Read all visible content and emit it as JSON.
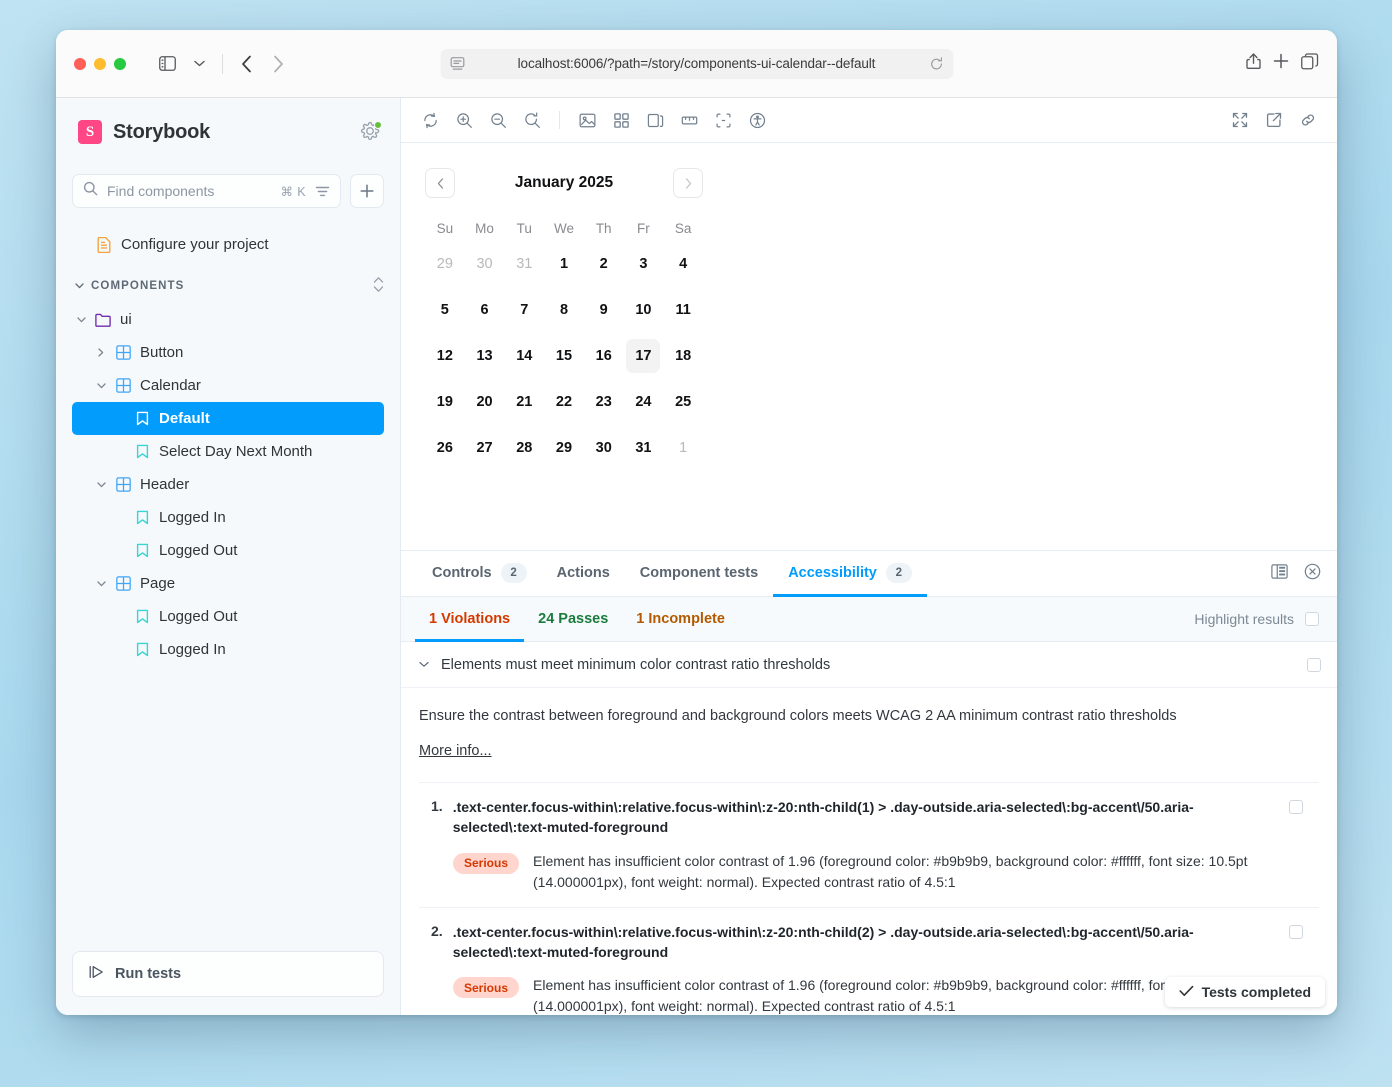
{
  "browser": {
    "url": "localhost:6006/?path=/story/components-ui-calendar--default",
    "back_icon": "chevron-left-icon",
    "forward_icon": "chevron-right-icon",
    "sidebar_toggle_icon": "sidebar-icon",
    "tab_dropdown_icon": "chevron-down-icon",
    "reader_icon": "reader-view-icon",
    "reload_icon": "reload-icon",
    "share_icon": "share-icon",
    "new_tab_icon": "plus-icon",
    "tab_overview_icon": "tabs-icon"
  },
  "sidebar": {
    "brand": "Storybook",
    "logo_letter": "S",
    "status_icon": "gear-icon",
    "search": {
      "placeholder": "Find components",
      "shortcut": "⌘ K",
      "filter_icon": "filter-icon"
    },
    "add_label": "+",
    "configure": {
      "label": "Configure your project",
      "icon": "document-icon"
    },
    "group": {
      "label": "COMPONENTS",
      "sort_icon": "sort-icon"
    },
    "tree": [
      {
        "label": "ui",
        "level": 1,
        "icon": "folder-icon",
        "expanded": true
      },
      {
        "label": "Button",
        "level": 2,
        "icon": "component-icon",
        "expanded": false
      },
      {
        "label": "Calendar",
        "level": 2,
        "icon": "component-icon",
        "expanded": true
      },
      {
        "label": "Default",
        "level": 3,
        "icon": "story-icon",
        "selected": true
      },
      {
        "label": "Select Day Next Month",
        "level": 3,
        "icon": "story-icon"
      },
      {
        "label": "Header",
        "level": 2,
        "icon": "component-icon",
        "expanded": true
      },
      {
        "label": "Logged In",
        "level": 3,
        "icon": "story-icon"
      },
      {
        "label": "Logged Out",
        "level": 3,
        "icon": "story-icon"
      },
      {
        "label": "Page",
        "level": 2,
        "icon": "component-icon",
        "expanded": true
      },
      {
        "label": "Logged Out",
        "level": 3,
        "icon": "story-icon"
      },
      {
        "label": "Logged In",
        "level": 3,
        "icon": "story-icon"
      }
    ],
    "run_tests": {
      "label": "Run tests",
      "icon": "play-icon"
    }
  },
  "toolbar": {
    "left": [
      "remount-icon",
      "zoom-in-icon",
      "zoom-out-icon",
      "zoom-reset-icon",
      "background-icon",
      "grid-icon",
      "viewport-icon",
      "measure-icon",
      "outline-icon",
      "accessibility-icon"
    ],
    "right": [
      "fullscreen-icon",
      "open-new-tab-icon",
      "copy-link-icon"
    ]
  },
  "calendar": {
    "title": "January 2025",
    "prev_label": "‹",
    "next_label": "›",
    "weekdays": [
      "Su",
      "Mo",
      "Tu",
      "We",
      "Th",
      "Fr",
      "Sa"
    ],
    "weeks": [
      [
        {
          "d": "29",
          "muted": true
        },
        {
          "d": "30",
          "muted": true
        },
        {
          "d": "31",
          "muted": true
        },
        {
          "d": "1"
        },
        {
          "d": "2"
        },
        {
          "d": "3"
        },
        {
          "d": "4"
        }
      ],
      [
        {
          "d": "5"
        },
        {
          "d": "6"
        },
        {
          "d": "7"
        },
        {
          "d": "8"
        },
        {
          "d": "9"
        },
        {
          "d": "10"
        },
        {
          "d": "11"
        }
      ],
      [
        {
          "d": "12"
        },
        {
          "d": "13"
        },
        {
          "d": "14"
        },
        {
          "d": "15"
        },
        {
          "d": "16"
        },
        {
          "d": "17",
          "today": true
        },
        {
          "d": "18"
        }
      ],
      [
        {
          "d": "19"
        },
        {
          "d": "20"
        },
        {
          "d": "21"
        },
        {
          "d": "22"
        },
        {
          "d": "23"
        },
        {
          "d": "24"
        },
        {
          "d": "25"
        }
      ],
      [
        {
          "d": "26"
        },
        {
          "d": "27"
        },
        {
          "d": "28"
        },
        {
          "d": "29"
        },
        {
          "d": "30"
        },
        {
          "d": "31"
        },
        {
          "d": "1",
          "muted": true
        }
      ]
    ]
  },
  "panel": {
    "tabs": [
      {
        "label": "Controls",
        "count": "2",
        "active": false
      },
      {
        "label": "Actions",
        "count": "",
        "active": false
      },
      {
        "label": "Component tests",
        "count": "",
        "active": false
      },
      {
        "label": "Accessibility",
        "count": "2",
        "active": true
      }
    ],
    "layout_icon": "panel-position-icon",
    "close_icon": "close-icon"
  },
  "a11y": {
    "tabs": [
      {
        "label": "1 Violations",
        "kind": "violations",
        "active": true
      },
      {
        "label": "24 Passes",
        "kind": "passes",
        "active": false
      },
      {
        "label": "1 Incomplete",
        "kind": "incomplete",
        "active": false
      }
    ],
    "highlight_label": "Highlight results",
    "rule_title": "Elements must meet minimum color contrast ratio thresholds",
    "rule_description": "Ensure the contrast between foreground and background colors meets WCAG 2 AA minimum contrast ratio thresholds",
    "more_info": "More info...",
    "violations": [
      {
        "num": "1.",
        "selector": ".text-center.focus-within\\:relative.focus-within\\:z-20:nth-child(1) > .day-outside.aria-selected\\:bg-accent\\/50.aria-selected\\:text-muted-foreground",
        "impact": "Serious",
        "detail": "Element has insufficient color contrast of 1.96 (foreground color: #b9b9b9, background color: #ffffff, font size: 10.5pt (14.000001px), font weight: normal). Expected contrast ratio of 4.5:1"
      },
      {
        "num": "2.",
        "selector": ".text-center.focus-within\\:relative.focus-within\\:z-20:nth-child(2) > .day-outside.aria-selected\\:bg-accent\\/50.aria-selected\\:text-muted-foreground",
        "impact": "Serious",
        "detail": "Element has insufficient color contrast of 1.96 (foreground color: #b9b9b9, background color: #ffffff, font size: 10.5pt (14.000001px), font weight: normal). Expected contrast ratio of 4.5:1"
      }
    ],
    "status": {
      "label": "Tests completed",
      "icon": "check-icon"
    }
  },
  "colors": {
    "accent": "#029cfd",
    "brand": "#ff4785",
    "violation": "#d43900",
    "pass": "#1b7c3d",
    "incomplete": "#b35a00",
    "badge_bg": "#ffd5cd"
  }
}
